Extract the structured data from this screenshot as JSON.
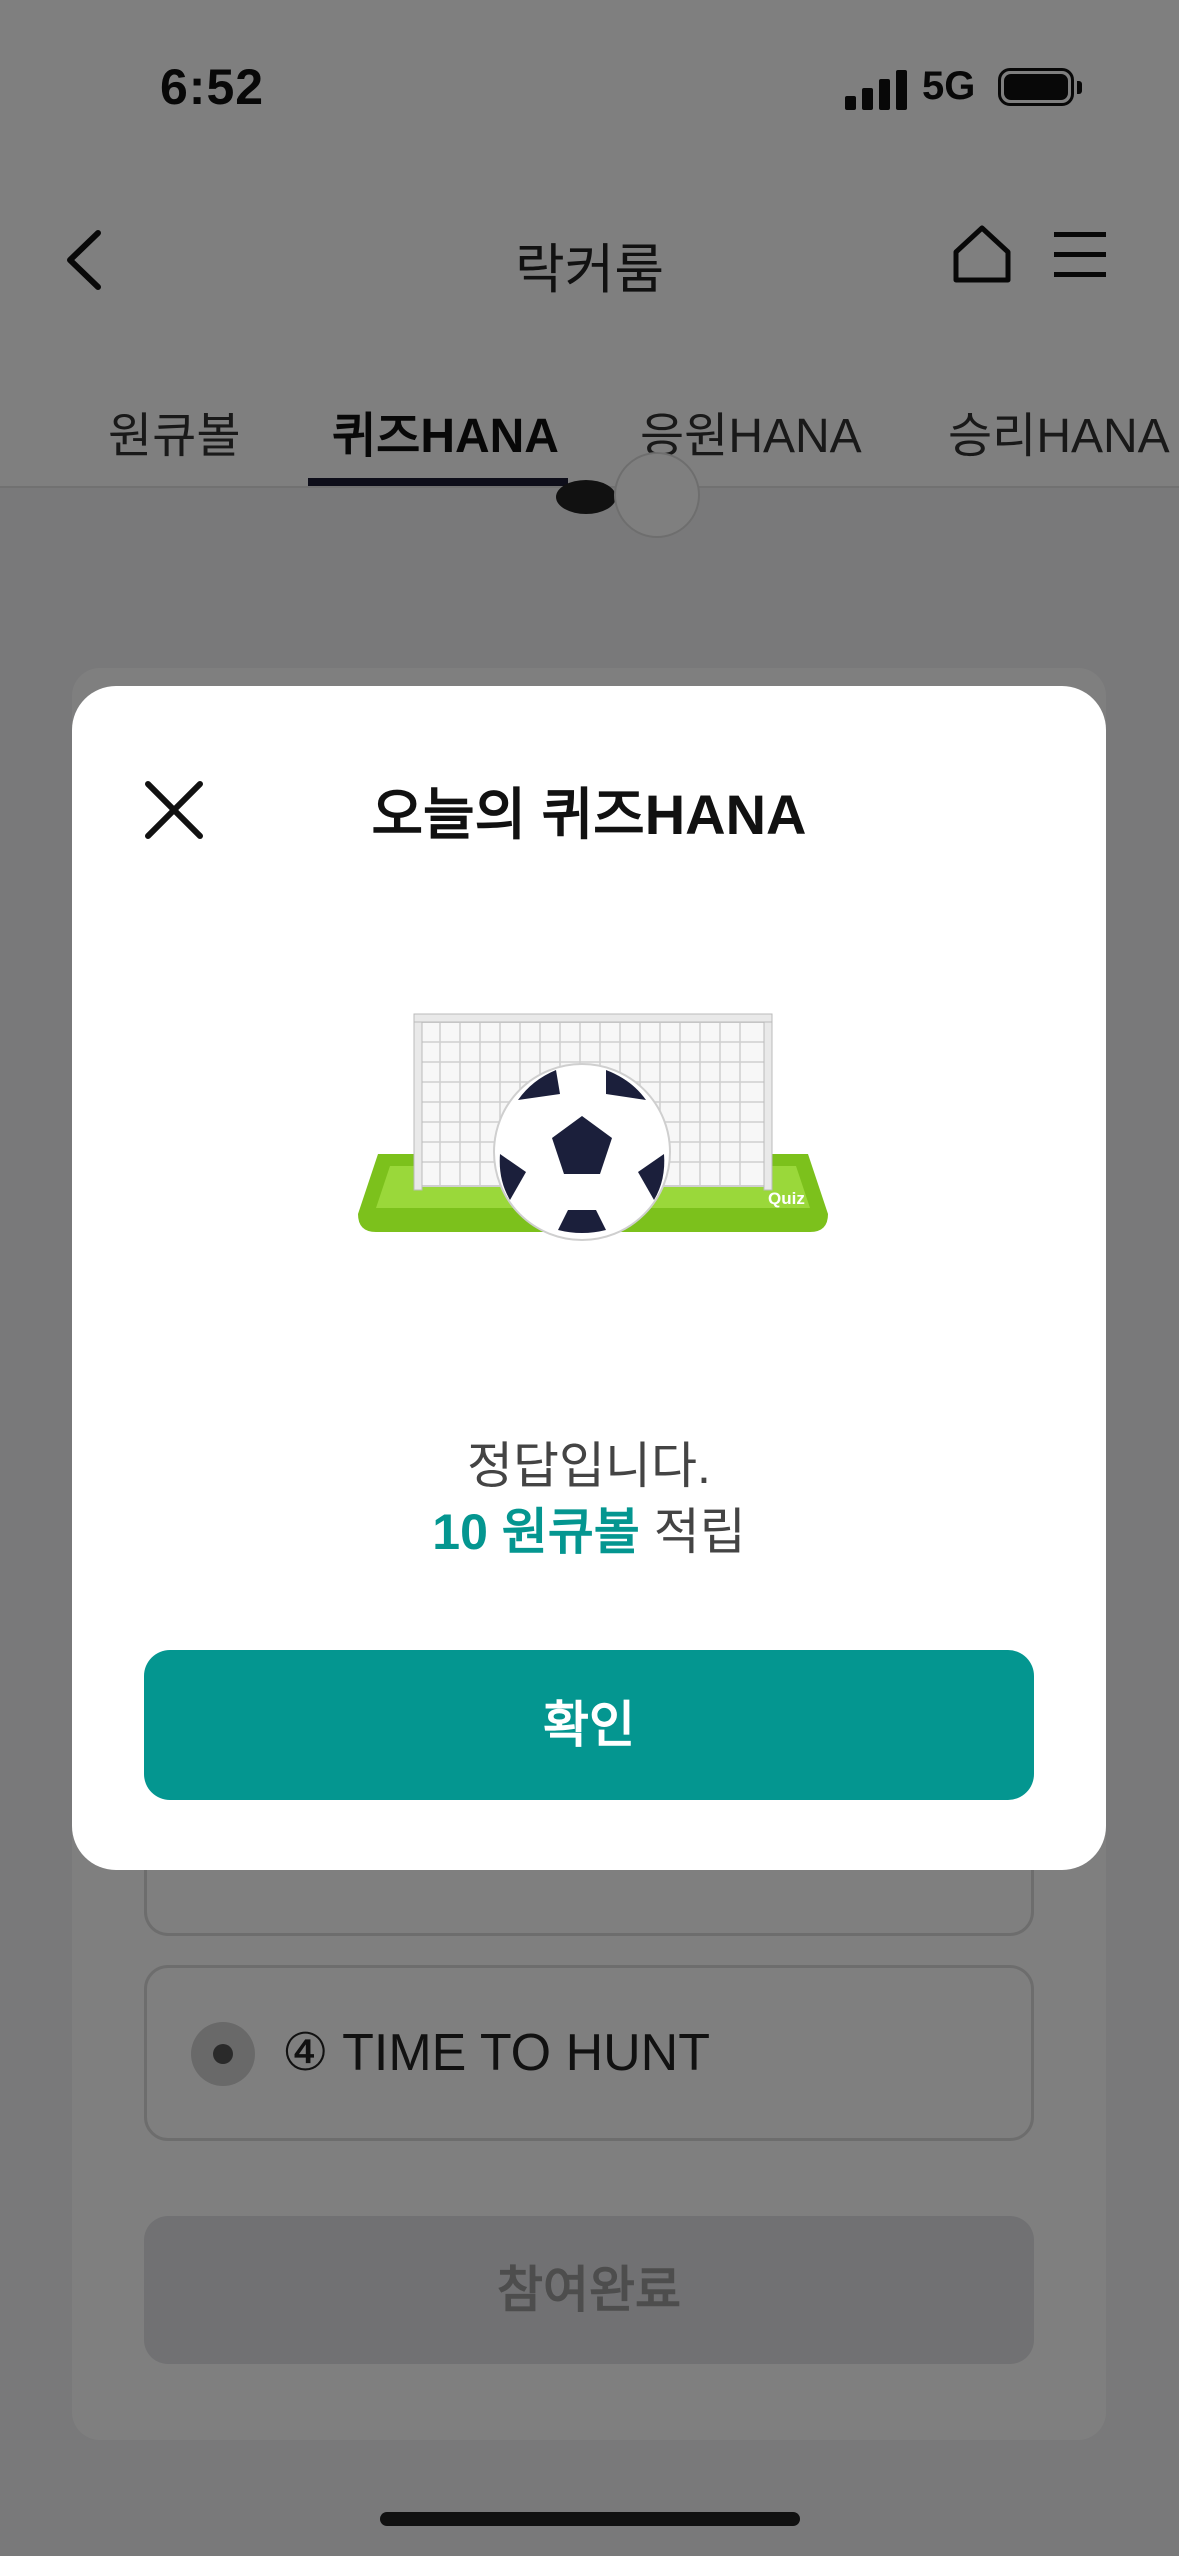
{
  "status_bar": {
    "time": "6:52",
    "network": "5G",
    "battery_icon": "battery-icon",
    "signal_icon": "signal-icon"
  },
  "header": {
    "title": "락커룸",
    "back_icon": "chevron-left-icon",
    "home_icon": "home-icon",
    "menu_icon": "hamburger-menu-icon"
  },
  "tabs": [
    {
      "label": "원큐볼",
      "active": false
    },
    {
      "label": "퀴즈HANA",
      "active": true
    },
    {
      "label": "응원HANA",
      "active": false
    },
    {
      "label": "승리HANA",
      "active": false
    }
  ],
  "quiz": {
    "options": [
      {
        "number": "④",
        "label": "④ TIME TO HUNT",
        "selected": true
      }
    ],
    "submit_label": "참여완료"
  },
  "modal": {
    "title": "오늘의 퀴즈HANA",
    "close_icon": "close-icon",
    "illustration_label": "Quiz",
    "message": "정답입니다.",
    "reward_amount": "10 원큐볼",
    "reward_suffix": " 적립",
    "confirm_label": "확인"
  },
  "colors": {
    "accent": "#049690",
    "dim_overlay": "rgba(0,0,0,0.5)",
    "tab_indicator": "#1d1d35"
  }
}
